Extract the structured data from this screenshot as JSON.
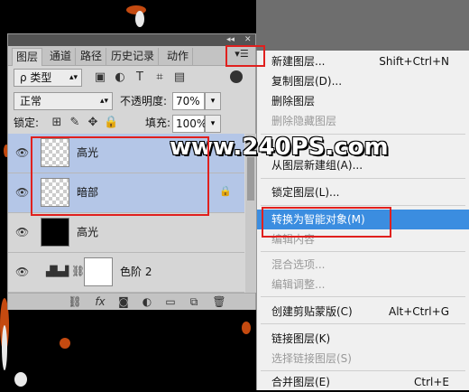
{
  "panel": {
    "tabs": [
      "图层",
      "通道",
      "路径",
      "历史记录",
      "动作"
    ],
    "window_controls": [
      "◂◂",
      "✕"
    ],
    "menu_icon": "panel-menu-icon",
    "filter_label": "ρ 类型",
    "blend_mode": "正常",
    "opacity_label": "不透明度:",
    "opacity_value": "70%",
    "lock_label": "锁定:",
    "fill_label": "填充:",
    "fill_value": "100%",
    "layers": [
      {
        "name": "高光",
        "thumb": "transparent",
        "selected": true
      },
      {
        "name": "暗部",
        "thumb": "transparent",
        "selected": true,
        "locked": true
      },
      {
        "name": "高光",
        "thumb": "dark",
        "selected": false
      },
      {
        "name": "色阶 2",
        "thumb": "white",
        "selected": false
      }
    ]
  },
  "menu": {
    "items": [
      {
        "label": "新建图层...",
        "shortcut": "Shift+Ctrl+N",
        "disabled": false
      },
      {
        "label": "复制图层(D)...",
        "shortcut": "",
        "disabled": false
      },
      {
        "label": "删除图层",
        "shortcut": "",
        "disabled": false
      },
      {
        "label": "删除隐藏图层",
        "shortcut": "",
        "disabled": true
      },
      {
        "label": "从图层新建组(A)...",
        "shortcut": "",
        "disabled": false
      },
      {
        "label": "锁定图层(L)...",
        "shortcut": "",
        "disabled": false
      },
      {
        "label": "转换为智能对象(M)",
        "shortcut": "",
        "disabled": false,
        "active": true
      },
      {
        "label": "编辑内容",
        "shortcut": "",
        "disabled": true
      },
      {
        "label": "混合选项...",
        "shortcut": "",
        "disabled": true
      },
      {
        "label": "编辑调整...",
        "shortcut": "",
        "disabled": true
      },
      {
        "label": "创建剪贴蒙版(C)",
        "shortcut": "Alt+Ctrl+G",
        "disabled": false
      },
      {
        "label": "链接图层(K)",
        "shortcut": "",
        "disabled": false
      },
      {
        "label": "选择链接图层(S)",
        "shortcut": "",
        "disabled": true
      },
      {
        "label": "合并图层(E)",
        "shortcut": "Ctrl+E",
        "disabled": false
      }
    ]
  },
  "watermark": "www.240PS.com",
  "colors": {
    "selection": "#b4c6e7",
    "menu_active": "#3b8de0",
    "annotation": "#e0201e"
  }
}
